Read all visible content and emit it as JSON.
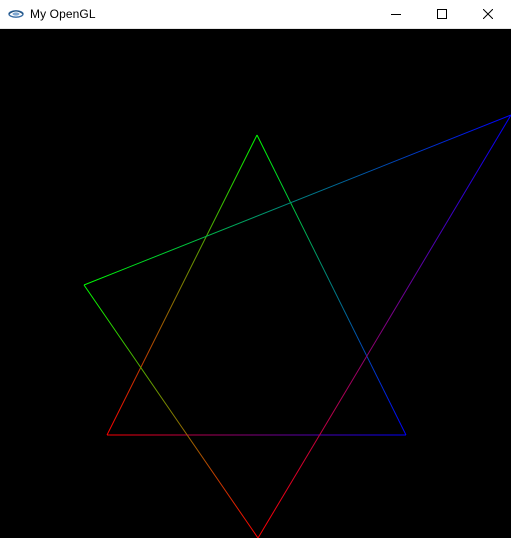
{
  "window": {
    "title": "My OpenGL",
    "icon": "opengl-app-icon"
  },
  "controls": {
    "minimize_icon": "minimize-icon",
    "maximize_icon": "maximize-icon",
    "close_icon": "close-icon"
  },
  "scene": {
    "background": "#000000",
    "colors": {
      "red": "#ff0000",
      "green": "#00ff00",
      "blue": "#0000ff"
    },
    "triangles": [
      {
        "name": "upright-triangle",
        "vertex_colors": [
          "#00ff00",
          "#0000ff",
          "#ff0000"
        ]
      },
      {
        "name": "rotated-triangle",
        "vertex_colors": [
          "#00ff00",
          "#0000ff",
          "#ff0000"
        ]
      }
    ]
  }
}
